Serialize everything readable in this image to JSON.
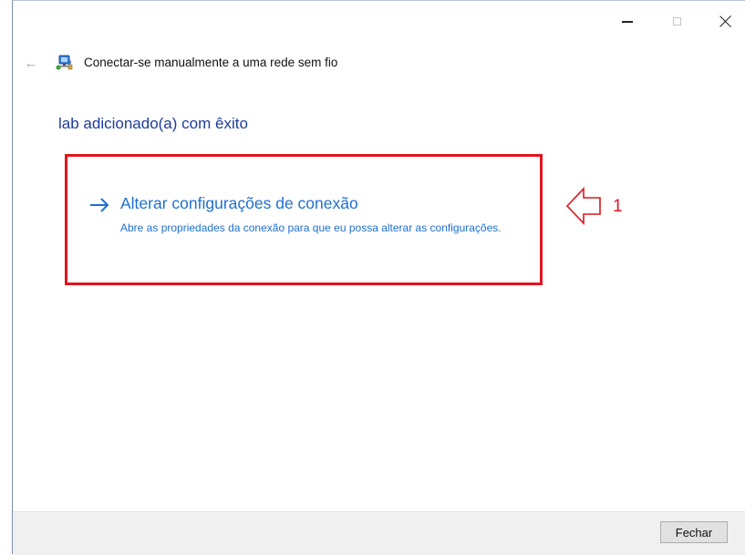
{
  "window": {
    "title": "Conectar-se manualmente a uma rede sem fio",
    "controls": {
      "minimize_icon": "minimize-icon",
      "maximize_icon": "maximize-icon",
      "close_icon": "close-icon"
    }
  },
  "nav": {
    "back_icon": "back-arrow-icon",
    "back_glyph": "←",
    "network_icon": "wireless-network-icon"
  },
  "main": {
    "headline": "lab adicionado(a) com êxito",
    "command_link": {
      "arrow_icon": "right-arrow-icon",
      "title": "Alterar configurações de conexão",
      "description": "Abre as propriedades da conexão para que eu possa alterar as configurações."
    }
  },
  "annotation": {
    "number": "1",
    "color": "#e0141e",
    "arrow_icon": "outline-left-arrow-icon"
  },
  "footer": {
    "close_label": "Fechar"
  },
  "colors": {
    "link_blue": "#1f6fcf",
    "headline_blue": "#1c3b9c",
    "footer_bg": "#f0f0f0"
  }
}
